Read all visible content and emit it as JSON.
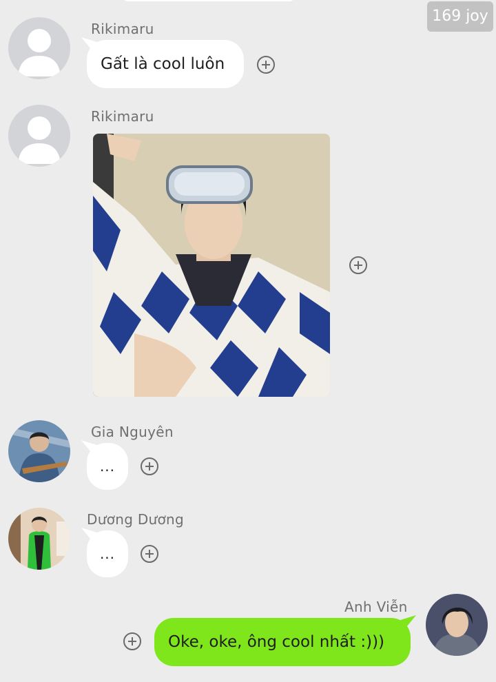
{
  "watermark": "169 joy",
  "messages": [
    {
      "sender": "Rikimaru",
      "text": "Gất là cool luôn",
      "avatar": "default-avatar"
    },
    {
      "sender": "Rikimaru",
      "type": "photo",
      "avatar": "default-avatar"
    },
    {
      "sender": "Gia Nguyên",
      "text": "...",
      "avatar": "user-avatar-gia-nguyen"
    },
    {
      "sender": "Dương Dương",
      "text": "...",
      "avatar": "user-avatar-duong-duong"
    },
    {
      "sender": "Anh Viễn",
      "text": "Oke, oke, ông cool nhất :)))",
      "avatar": "user-avatar-anh-vien",
      "outgoing": true
    }
  ],
  "colors": {
    "background": "#ececec",
    "incoming_bubble": "#ffffff",
    "outgoing_bubble": "#80e61c",
    "sender_name": "#6f6f6f"
  },
  "icons": [
    "plus-circle-icon",
    "default-avatar-icon"
  ]
}
